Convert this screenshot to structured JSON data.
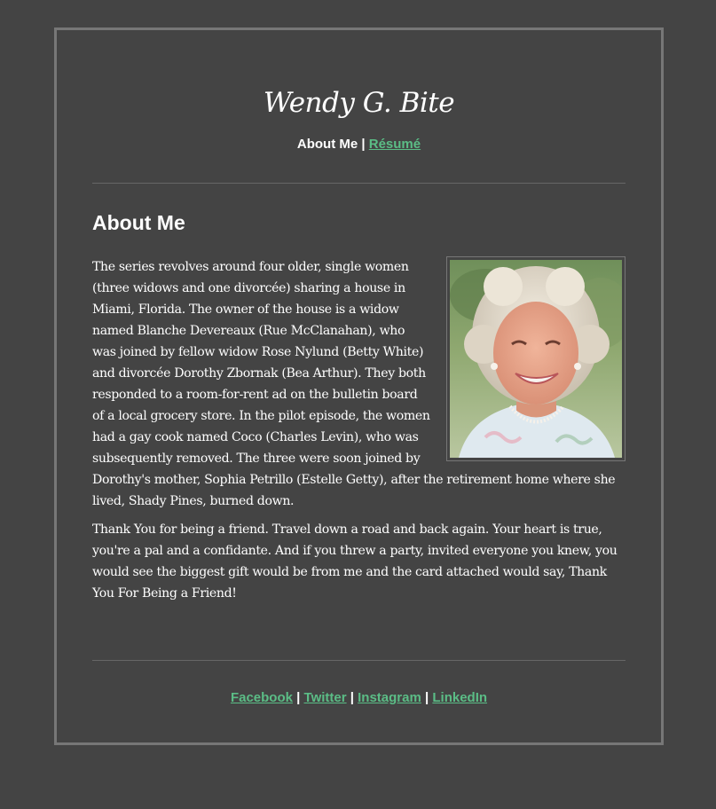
{
  "site": {
    "title": "Wendy G. Bite"
  },
  "nav": {
    "current": "About Me",
    "separator": "|",
    "resume_link": "Résumé"
  },
  "main": {
    "heading": "About Me",
    "photo_alt": "Portrait of a smiling older woman with curly white hair",
    "paragraph1": "The series revolves around four older, single women (three widows and one divorcée) sharing a house in Miami, Florida. The owner of the house is a widow named Blanche Devereaux (Rue McClanahan), who was joined by fellow widow Rose Nylund (Betty White) and divorcée Dorothy Zbornak (Bea Arthur). They both responded to a room-for-rent ad on the bulletin board of a local grocery store. In the pilot episode, the women had a gay cook named Coco (Charles Levin), who was subsequently removed. The three were soon joined by Dorothy's mother, Sophia Petrillo (Estelle Getty), after the retirement home where she lived, Shady Pines, burned down.",
    "paragraph2": "Thank You for being a friend. Travel down a road and back again. Your heart is true, you're a pal and a confidante. And if you threw a party, invited everyone you knew, you would see the biggest gift would be from me and the card attached would say, Thank You For Being a Friend!"
  },
  "footer": {
    "links": [
      "Facebook",
      "Twitter",
      "Instagram",
      "LinkedIn"
    ],
    "separator": "|"
  },
  "colors": {
    "background": "#444444",
    "frame_border": "#777777",
    "link": "#5bbd86",
    "text": "#ffffff"
  }
}
